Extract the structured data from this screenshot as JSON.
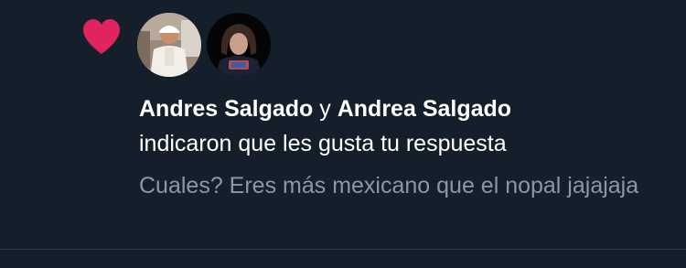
{
  "notification": {
    "type_icon": "heart-icon",
    "accent_color": "#e0245e",
    "avatars": [
      {
        "name": "avatar-andres",
        "icon": "user-photo"
      },
      {
        "name": "avatar-andrea",
        "icon": "user-photo"
      }
    ],
    "user1": "Andres Salgado",
    "conjunction": "y",
    "user2": "Andrea Salgado",
    "action_text": "indicaron que les gusta tu respuesta",
    "tweet_preview": "Cuales? Eres más mexicano que el nopal jajajaja"
  }
}
